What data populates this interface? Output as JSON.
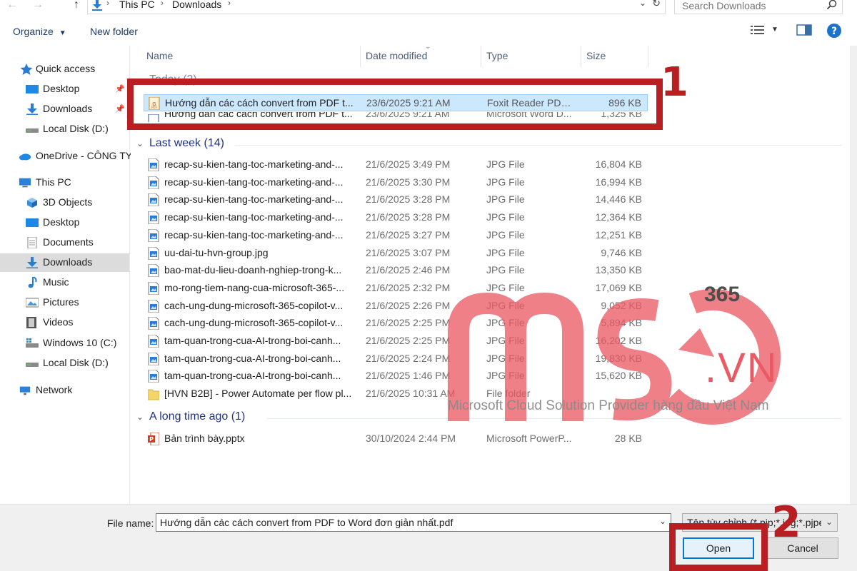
{
  "address": {
    "crumbs": [
      "This PC",
      "Downloads"
    ],
    "search_placeholder": "Search Downloads"
  },
  "toolbar": {
    "organize": "Organize",
    "new_folder": "New folder"
  },
  "nav": {
    "items": [
      {
        "label": "Quick access",
        "icon": "star-icon"
      },
      {
        "label": "Desktop",
        "icon": "desktop-icon"
      },
      {
        "label": "Downloads",
        "icon": "download-icon"
      },
      {
        "label": "Local Disk (D:)",
        "icon": "drive-icon"
      },
      {
        "label": "OneDrive - CÔNG TY",
        "icon": "cloud-icon"
      },
      {
        "label": "This PC",
        "icon": "computer-icon"
      },
      {
        "label": "3D Objects",
        "icon": "cube-icon"
      },
      {
        "label": "Desktop",
        "icon": "desktop-icon"
      },
      {
        "label": "Documents",
        "icon": "document-icon"
      },
      {
        "label": "Downloads",
        "icon": "download-icon"
      },
      {
        "label": "Music",
        "icon": "music-icon"
      },
      {
        "label": "Pictures",
        "icon": "picture-icon"
      },
      {
        "label": "Videos",
        "icon": "video-icon"
      },
      {
        "label": "Windows 10 (C:)",
        "icon": "windows-drive-icon"
      },
      {
        "label": "Local Disk (D:)",
        "icon": "drive-icon"
      },
      {
        "label": "Network",
        "icon": "network-icon"
      }
    ],
    "selected_index": 9
  },
  "columns": {
    "name": "Name",
    "date": "Date modified",
    "type": "Type",
    "size": "Size"
  },
  "groups": {
    "today": "Today (2)",
    "last_week": "Last week (14)",
    "long_ago": "A long time ago (1)"
  },
  "files": [
    {
      "name": "Hướng dẫn các cách convert from PDF t...",
      "date": "23/6/2025 9:21 AM",
      "type": "Foxit Reader PDF ...",
      "size": "896 KB",
      "icon": "pdf-icon"
    },
    {
      "name": "Hướng dẫn các cách convert from PDF t...",
      "date": "23/6/2025 9:21 AM",
      "type": "Microsoft Word D...",
      "size": "1,325 KB",
      "icon": "word-icon"
    },
    {
      "name": "recap-su-kien-tang-toc-marketing-and-...",
      "date": "21/6/2025 3:49 PM",
      "type": "JPG File",
      "size": "16,804 KB",
      "icon": "image-file-icon"
    },
    {
      "name": "recap-su-kien-tang-toc-marketing-and-...",
      "date": "21/6/2025 3:30 PM",
      "type": "JPG File",
      "size": "16,994 KB",
      "icon": "image-file-icon"
    },
    {
      "name": "recap-su-kien-tang-toc-marketing-and-...",
      "date": "21/6/2025 3:28 PM",
      "type": "JPG File",
      "size": "14,446 KB",
      "icon": "image-file-icon"
    },
    {
      "name": "recap-su-kien-tang-toc-marketing-and-...",
      "date": "21/6/2025 3:28 PM",
      "type": "JPG File",
      "size": "12,364 KB",
      "icon": "image-file-icon"
    },
    {
      "name": "recap-su-kien-tang-toc-marketing-and-...",
      "date": "21/6/2025 3:27 PM",
      "type": "JPG File",
      "size": "12,251 KB",
      "icon": "image-file-icon"
    },
    {
      "name": "uu-dai-tu-hvn-group.jpg",
      "date": "21/6/2025 3:07 PM",
      "type": "JPG File",
      "size": "9,746 KB",
      "icon": "image-file-icon"
    },
    {
      "name": "bao-mat-du-lieu-doanh-nghiep-trong-k...",
      "date": "21/6/2025 2:46 PM",
      "type": "JPG File",
      "size": "13,350 KB",
      "icon": "image-file-icon"
    },
    {
      "name": "mo-rong-tiem-nang-cua-microsoft-365-...",
      "date": "21/6/2025 2:32 PM",
      "type": "JPG File",
      "size": "17,069 KB",
      "icon": "image-file-icon"
    },
    {
      "name": "cach-ung-dung-microsoft-365-copilot-v...",
      "date": "21/6/2025 2:26 PM",
      "type": "JPG File",
      "size": "9,052 KB",
      "icon": "image-file-icon"
    },
    {
      "name": "cach-ung-dung-microsoft-365-copilot-v...",
      "date": "21/6/2025 2:25 PM",
      "type": "JPG File",
      "size": "5,894 KB",
      "icon": "image-file-icon"
    },
    {
      "name": "tam-quan-trong-cua-AI-trong-boi-canh...",
      "date": "21/6/2025 2:25 PM",
      "type": "JPG File",
      "size": "16,202 KB",
      "icon": "image-file-icon"
    },
    {
      "name": "tam-quan-trong-cua-AI-trong-boi-canh...",
      "date": "21/6/2025 2:24 PM",
      "type": "JPG File",
      "size": "19,830 KB",
      "icon": "image-file-icon"
    },
    {
      "name": "tam-quan-trong-cua-AI-trong-boi-canh...",
      "date": "21/6/2025 1:46 PM",
      "type": "JPG File",
      "size": "15,620 KB",
      "icon": "image-file-icon"
    },
    {
      "name": "[HVN B2B] - Power Automate per flow pl...",
      "date": "21/6/2025 10:31 AM",
      "type": "File folder",
      "size": "",
      "icon": "folder-icon"
    },
    {
      "name": "Bản trình bày.pptx",
      "date": "30/10/2024 2:44 PM",
      "type": "Microsoft PowerP...",
      "size": "28 KB",
      "icon": "powerpoint-icon"
    }
  ],
  "bottom": {
    "file_name_label": "File name:",
    "file_name_value": "Hướng dẫn các cách convert from PDF to Word đơn giản nhất.pdf",
    "file_type": "Tên tùy chỉnh (*.pip;*.jpg;*.pjpe",
    "open": "Open",
    "cancel": "Cancel"
  },
  "annotations": {
    "step1": "1",
    "step2": "2"
  },
  "watermark": {
    "brand": "MSO",
    "suffix_365": "365",
    "domain": ".VN",
    "tagline": "Microsoft Cloud Solution Provider hàng đầu Việt Nam"
  },
  "colors": {
    "accent": "#0078d7",
    "selection": "#cce8ff",
    "annotation_red": "#b81e22",
    "watermark_red": "#ea5a64",
    "group_header": "#1e3287"
  }
}
